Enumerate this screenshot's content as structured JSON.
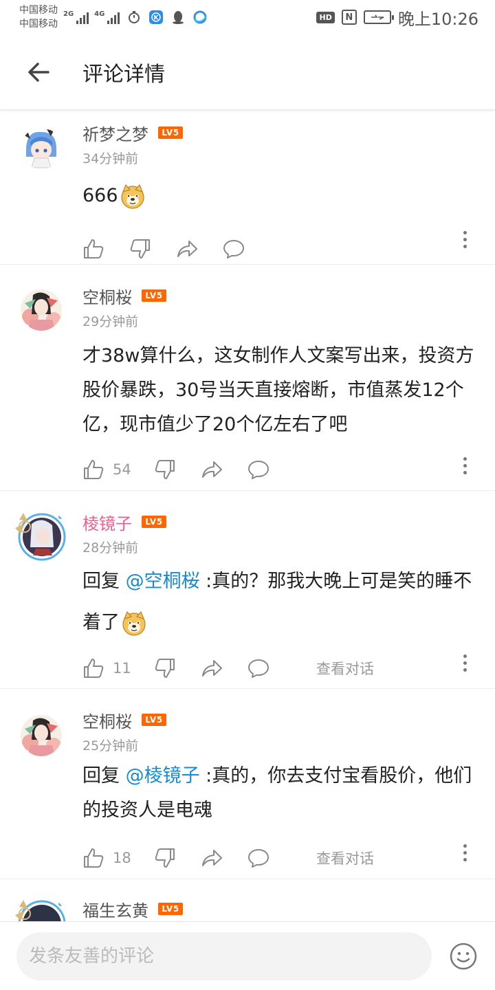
{
  "status_bar": {
    "carrier1": "中国移动",
    "carrier2": "中国移动",
    "net1": "2G",
    "net2": "4G",
    "hd": "HD",
    "nfc": "N",
    "clock": "晚上10:26"
  },
  "header": {
    "title": "评论详情"
  },
  "level_badge": "LV5",
  "comments": [
    {
      "username": "祈梦之梦",
      "time": "34分钟前",
      "text": "666",
      "likes": ""
    },
    {
      "username": "空桐桜",
      "time": "29分钟前",
      "text": "才38w算什么，这女制作人文案写出来，投资方股价暴跌，30号当天直接熔断，市值蒸发12个亿，现市值少了20个亿左右了吧",
      "likes": "54"
    },
    {
      "username": "棱镜子",
      "time": "28分钟前",
      "reply_prefix": "回复 ",
      "mention": "@空桐桜",
      "text": " :真的？那我大晚上可是笑的睡不着了",
      "likes": "11",
      "view_conversation": "查看对话"
    },
    {
      "username": "空桐桜",
      "time": "25分钟前",
      "reply_prefix": "回复 ",
      "mention": "@棱镜子",
      "text": " :真的，你去支付宝看股价，他们的投资人是电魂",
      "likes": "18",
      "view_conversation": "查看对话"
    },
    {
      "username": "福生玄黄",
      "time": "",
      "text": ""
    }
  ],
  "input": {
    "placeholder": "发条友善的评论"
  },
  "colors": {
    "level_badge": "#ff6600",
    "mention": "#178bcf",
    "vip_name": "#f25d8e",
    "icon_gray": "#888888"
  },
  "icons": {
    "back": "arrow-left-icon",
    "like": "thumbs-up-icon",
    "dislike": "thumbs-down-icon",
    "share": "share-icon",
    "reply": "chat-bubble-icon",
    "more": "more-vertical-icon",
    "emoji": "smiley-icon"
  }
}
